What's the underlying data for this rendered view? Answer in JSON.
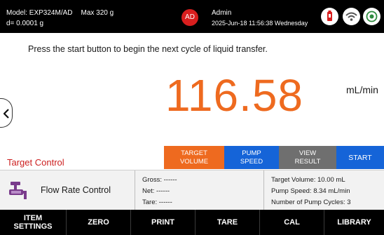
{
  "status_bar": {
    "model_line": "Model: EXP324M/AD",
    "max_line": "Max 320 g",
    "d_line": "d= 0.0001 g",
    "avatar_initials": "AD",
    "user_name": "Admin",
    "datetime": "2025-Jun-18 11:56:38 Wednesday",
    "icons": [
      "usb-icon",
      "wifi-icon",
      "target-icon"
    ]
  },
  "main": {
    "instruction": "Press the start button to begin the next cycle of liquid transfer.",
    "reading_value": "116.58",
    "reading_unit": "mL/min",
    "target_control_label": "Target Control"
  },
  "function_buttons": {
    "target_volume": "TARGET\nVOLUME",
    "pump_speed": "PUMP\nSPEED",
    "view_result": "VIEW\nRESULT",
    "start": "START"
  },
  "info_panel": {
    "mode_label": "Flow Rate Control",
    "gross": "Gross: ------",
    "net": "Net: ------",
    "tare": "Tare: ------",
    "target_volume": "Target Volume: 10.00 mL",
    "pump_speed": "Pump Speed: 8.34 mL/min",
    "pump_cycles": "Number of Pump Cycles: 3"
  },
  "bottom_nav": {
    "item_settings": "ITEM\nSETTINGS",
    "zero": "ZERO",
    "print": "PRINT",
    "tare": "TARE",
    "cal": "CAL",
    "library": "LIBRARY"
  },
  "colors": {
    "accent_orange": "#ee6a1f",
    "accent_blue": "#1564d8",
    "neutral_gray": "#6f6f6f",
    "alert_red": "#cc1f1f",
    "avatar_red": "#d81e1e"
  }
}
